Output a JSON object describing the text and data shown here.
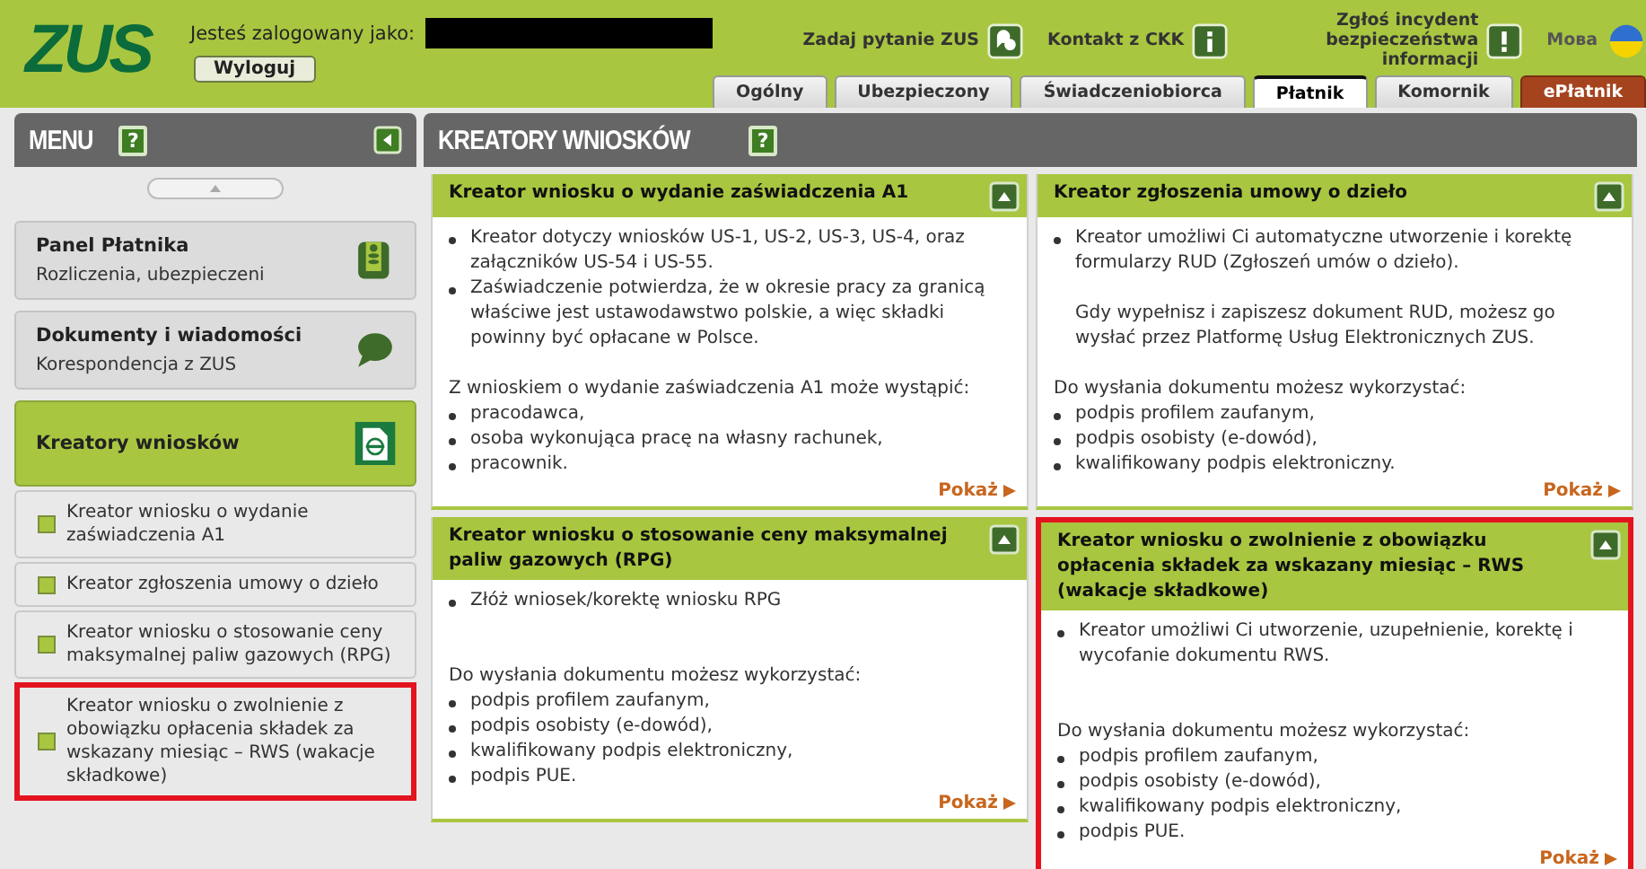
{
  "header": {
    "logo": "ZUS",
    "login_label": "Jesteś zalogowany jako:",
    "logout": "Wyloguj",
    "links": [
      {
        "label": "Zadaj pytanie ZUS"
      },
      {
        "label": "Kontakt z CKK"
      },
      {
        "label": "Zgłoś incydent bezpieczeństwa informacji"
      }
    ],
    "language": "Мова"
  },
  "tabs": [
    {
      "label": "Ogólny",
      "selected": false,
      "kind": "standard"
    },
    {
      "label": "Ubezpieczony",
      "selected": false,
      "kind": "standard"
    },
    {
      "label": "Świadczeniobiorca",
      "selected": false,
      "kind": "standard"
    },
    {
      "label": "Płatnik",
      "selected": true,
      "kind": "standard"
    },
    {
      "label": "Komornik",
      "selected": false,
      "kind": "standard"
    },
    {
      "label": "ePłatnik",
      "selected": false,
      "kind": "accent"
    }
  ],
  "sidebar": {
    "title": "MENU",
    "help": "?",
    "items": [
      {
        "title": "Panel Płatnika",
        "subtitle": "Rozliczenia, ubezpieczeni",
        "selected": false
      },
      {
        "title": "Dokumenty i wiadomości",
        "subtitle": "Korespondencja z ZUS",
        "selected": false
      },
      {
        "title": "Kreatory wniosków",
        "selected": true
      }
    ],
    "subitems": [
      {
        "label": "Kreator wniosku o wydanie zaświadczenia A1",
        "highlighted": false
      },
      {
        "label": "Kreator zgłoszenia umowy o dzieło",
        "highlighted": false
      },
      {
        "label": "Kreator wniosku o stosowanie ceny maksymalnej paliw gazowych (RPG)",
        "highlighted": false
      },
      {
        "label": "Kreator wniosku o zwolnienie z obowiązku opłacenia składek za wskazany miesiąc – RWS (wakacje składkowe)",
        "highlighted": true
      }
    ]
  },
  "main": {
    "title": "KREATORY WNIOSKÓW",
    "help": "?",
    "cards": [
      {
        "title": "Kreator wniosku o wydanie zaświadczenia A1",
        "highlighted": false,
        "link": "Pokaż",
        "blocks": [
          {
            "kind": "bullets",
            "items": [
              "Kreator dotyczy wniosków US-1, US-2, US-3, US-4, oraz załączników US-54 i US-55.",
              "Zaświadczenie potwierdza, że w okresie pracy za granicą właściwe jest ustawodawstwo polskie, a więc składki powinny być opłacane w Polsce."
            ]
          },
          {
            "kind": "text",
            "text": "Z wnioskiem o wydanie zaświadczenia A1 może wystąpić:"
          },
          {
            "kind": "bullets",
            "items": [
              "pracodawca,",
              "osoba wykonująca pracę na własny rachunek,",
              "pracownik."
            ]
          }
        ]
      },
      {
        "title": "Kreator zgłoszenia umowy o dzieło",
        "highlighted": false,
        "link": "Pokaż",
        "blocks": [
          {
            "kind": "bullets",
            "items": [
              "Kreator umożliwi Ci automatyczne utworzenie i korektę formularzy RUD (Zgłoszeń umów o dzieło)."
            ]
          },
          {
            "kind": "indent",
            "text": "Gdy wypełnisz i zapiszesz dokument RUD, możesz go wysłać przez Platformę Usług Elektronicznych ZUS."
          },
          {
            "kind": "text",
            "text": "Do wysłania dokumentu możesz wykorzystać:"
          },
          {
            "kind": "bullets",
            "items": [
              "podpis profilem zaufanym,",
              "podpis osobisty (e-dowód),",
              "kwalifikowany podpis elektroniczny."
            ]
          }
        ]
      },
      {
        "title": "Kreator wniosku o stosowanie ceny maksymalnej paliw gazowych (RPG)",
        "highlighted": false,
        "link": "Pokaż",
        "blocks": [
          {
            "kind": "bullets",
            "items": [
              "Złóż wniosek/korektę wniosku RPG"
            ]
          },
          {
            "kind": "text_far",
            "text": "Do wysłania dokumentu możesz wykorzystać:"
          },
          {
            "kind": "bullets",
            "items": [
              "podpis profilem zaufanym,",
              "podpis osobisty (e-dowód),",
              "kwalifikowany podpis elektroniczny,",
              "podpis PUE."
            ]
          }
        ]
      },
      {
        "title": "Kreator wniosku o zwolnienie z obowiązku opłacenia składek za wskazany miesiąc – RWS (wakacje składkowe)",
        "highlighted": true,
        "link": "Pokaż",
        "blocks": [
          {
            "kind": "bullets",
            "items": [
              "Kreator umożliwi Ci utworzenie, uzupełnienie, korektę i wycofanie dokumentu RWS."
            ]
          },
          {
            "kind": "text_far",
            "text": "Do wysłania dokumentu możesz wykorzystać:"
          },
          {
            "kind": "bullets",
            "items": [
              "podpis profilem zaufanym,",
              "podpis osobisty (e-dowód),",
              "kwalifikowany podpis elektroniczny,",
              "podpis PUE."
            ]
          }
        ]
      }
    ]
  }
}
